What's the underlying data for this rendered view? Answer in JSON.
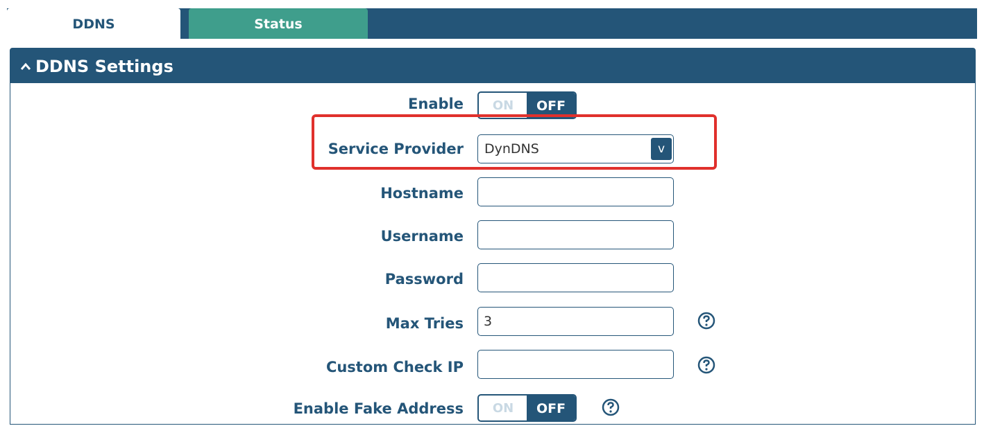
{
  "tabs": {
    "ddns": "DDNS",
    "status": "Status"
  },
  "panel": {
    "title": "DDNS Settings",
    "toggle_icon": "chevron-up-icon"
  },
  "form": {
    "enable": {
      "label": "Enable",
      "on": "ON",
      "off": "OFF"
    },
    "service_provider": {
      "label": "Service Provider",
      "value": "DynDNS",
      "arrow": "v"
    },
    "hostname": {
      "label": "Hostname",
      "value": ""
    },
    "username": {
      "label": "Username",
      "value": ""
    },
    "password": {
      "label": "Password",
      "value": ""
    },
    "max_tries": {
      "label": "Max Tries",
      "value": "3"
    },
    "custom_check_ip": {
      "label": "Custom Check IP",
      "value": ""
    },
    "enable_fake_address": {
      "label": "Enable Fake Address",
      "on": "ON",
      "off": "OFF"
    }
  },
  "colors": {
    "primary": "#245578",
    "tab_active_alt": "#3f9e8c",
    "highlight": "#e0302c"
  }
}
